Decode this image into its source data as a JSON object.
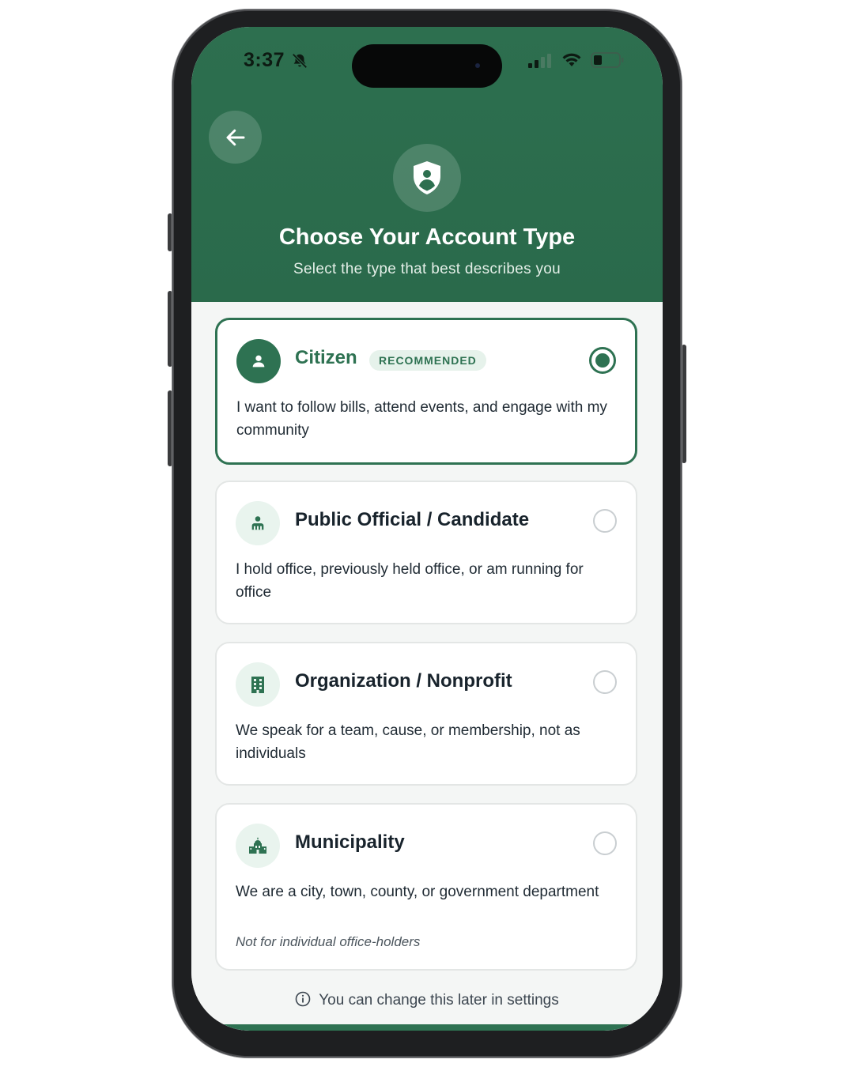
{
  "status_bar": {
    "time": "3:37"
  },
  "header": {
    "back_icon": "arrow-left-icon",
    "hero_icon": "shield-user-icon",
    "title": "Choose Your Account Type",
    "subtitle": "Select the type that best describes you"
  },
  "options": [
    {
      "icon": "person-icon",
      "title": "Citizen",
      "badge": "RECOMMENDED",
      "description": "I want to follow bills, attend events, and engage with my community",
      "selected": true
    },
    {
      "icon": "official-icon",
      "title": "Public Official / Candidate",
      "description": "I hold office, previously held office, or am running for office",
      "selected": false
    },
    {
      "icon": "building-icon",
      "title": "Organization / Nonprofit",
      "description": "We speak for a team, cause, or membership, not as individuals",
      "selected": false
    },
    {
      "icon": "city-hall-icon",
      "title": "Municipality",
      "description": "We are a city, town, county, or government department",
      "note": "Not for individual office-holders",
      "selected": false
    }
  ],
  "footer": {
    "info_icon": "info-icon",
    "text": "You can change this later in settings"
  },
  "colors": {
    "brand_green": "#2e7252",
    "header_green": "#2d6f4f",
    "badge_bg": "#e6f2eb"
  }
}
